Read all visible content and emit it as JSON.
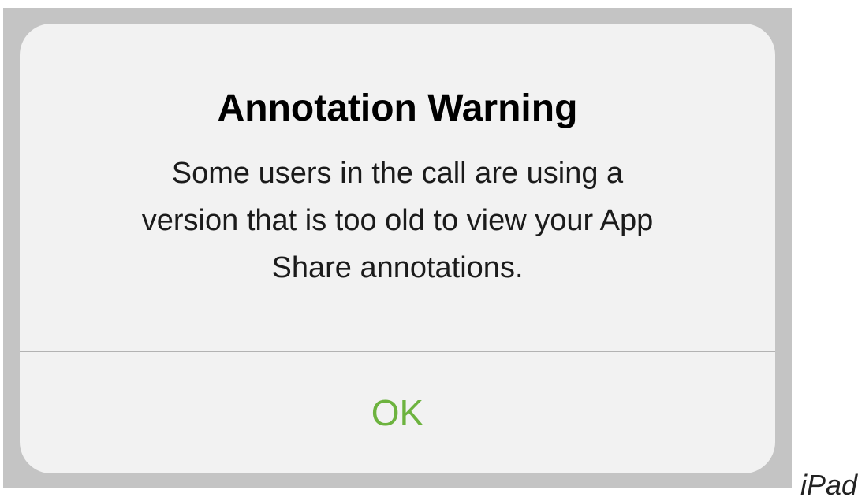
{
  "alert": {
    "title": "Annotation Warning",
    "message_lines": [
      "Some users in the call are using a",
      "version that is too old to view your App",
      "Share annotations."
    ],
    "ok_label": "OK",
    "ok_color": "#6db33f"
  },
  "caption": "iPad"
}
